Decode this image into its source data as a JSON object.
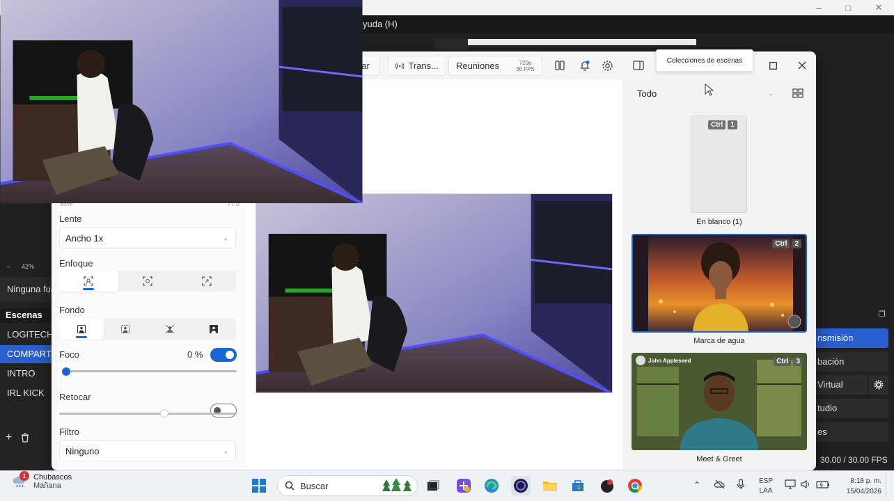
{
  "obs": {
    "menu_help": "yuda (H)",
    "zoom_percent": "42%",
    "no_source_label": "Ninguna fue",
    "scenes_title": "Escenas",
    "scenes": [
      "LOGITECH",
      "COMPARTI",
      "INTRO",
      "IRL KICK"
    ],
    "active_scene_index": 1,
    "controls": [
      "nsmisión",
      "bación",
      "Virtual",
      "tudio",
      "es"
    ],
    "fps": "30.00 / 30.00 FPS"
  },
  "hub": {
    "toolbar": {
      "record_label": "bar",
      "stream_label": "Trans...",
      "meetings_label": "Reuniones",
      "resolution": "720p",
      "framerate": "30 FPS"
    },
    "left": {
      "partial_top_left": "65%",
      "partial_top_right": "77.0",
      "lens_label": "Lente",
      "lens_value": "Ancho 1x",
      "focus_label": "Enfoque",
      "background_label": "Fondo",
      "blur_label": "Foco",
      "blur_value": "0 %",
      "blur_enabled": true,
      "blur_slider_fraction": 0.0,
      "retouch_label": "Retocar",
      "retouch_enabled": false,
      "retouch_slider_fraction": 0.6,
      "filter_label": "Filtro",
      "filter_value": "Ninguno"
    },
    "right": {
      "filter_select": "Todo",
      "tooltip": "Colecciones de escenas",
      "scenes": [
        {
          "name": "En blanco (1)",
          "shortcut_mod": "Ctrl",
          "shortcut_key": "1"
        },
        {
          "name": "Marca de agua",
          "shortcut_mod": "Ctrl",
          "shortcut_key": "2"
        },
        {
          "name": "Meet & Greet",
          "shortcut_mod": "Ctrl",
          "shortcut_key": "3",
          "caption_name": "John Appleseed"
        }
      ]
    }
  },
  "taskbar": {
    "weather_title": "Chubascos",
    "weather_sub": "Mañana",
    "weather_badge": "1",
    "search_placeholder": "Buscar",
    "lang_line1": "ESP",
    "lang_line2": "LAA",
    "time": "8:18 p. m.",
    "date": "15/04/2026"
  },
  "colors": {
    "accent": "#1a66d2",
    "obs_active": "#2a5fd0",
    "led_blue": "#3b3bff"
  }
}
